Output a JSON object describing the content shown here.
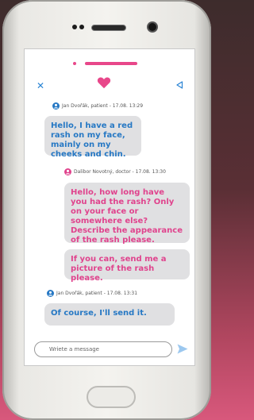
{
  "chat": {
    "messages": [
      {
        "sender": "Jan Dvořák, patient - 17.08. 13:29",
        "role": "patient",
        "text": "Hello, I have a red rash on my face, mainly on my cheeks and chin."
      },
      {
        "sender": "Dalibor Novotný, doctor - 17.08. 13:30",
        "role": "doctor",
        "text": "Hello, how long have you had the rash? Only on your face or somewhere else? Describe the appearance of the rash please."
      },
      {
        "sender": "",
        "role": "doctor",
        "text": "If you can, send me a picture of the rash please."
      },
      {
        "sender": "Jan Dvořák, patient - 17.08. 13:31",
        "role": "patient",
        "text": "Of course, I'll send it."
      }
    ]
  },
  "composer": {
    "placeholder": "Wriete a message"
  },
  "icons": {
    "close": "close-icon",
    "heart": "heart-icon",
    "back": "back-icon",
    "send": "send-icon",
    "avatar": "user-avatar-icon"
  },
  "colors": {
    "accent_pink": "#e8478a",
    "patient_blue": "#2678c4",
    "doctor_pink": "#e0438d",
    "bubble_gray": "#e0e0e2"
  }
}
